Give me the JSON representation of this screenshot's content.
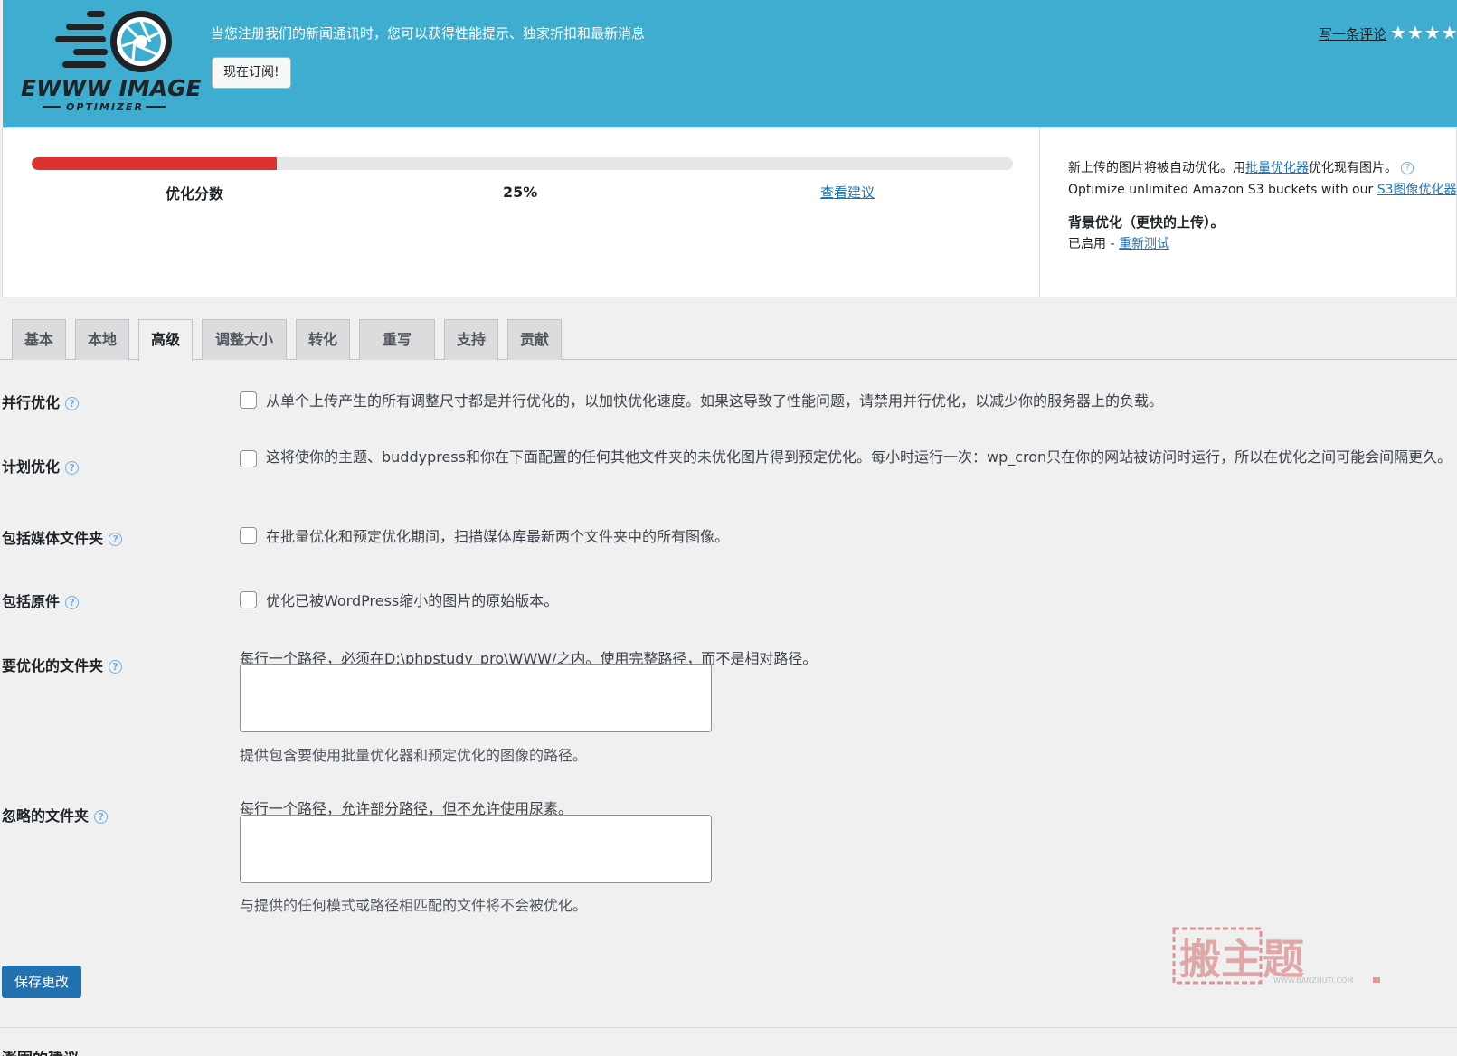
{
  "banner": {
    "logo_text": "EWWW IMAGE",
    "logo_subtext": "OPTIMIZER",
    "newsletter_text": "当您注册我们的新闻通讯时，您可以获得性能提示、独家折扣和最新消息",
    "subscribe_label": "现在订阅!",
    "review_link": "写一条评论",
    "review_stars": "★★★★",
    "bg_color": "#3eadcf"
  },
  "score": {
    "label": "优化分数",
    "percent_text": "25%",
    "percent_value": 25,
    "view_link": "查看建议",
    "fill_color": "#dc3232"
  },
  "side": {
    "line1_prefix": "新上传的图片将被自动优化。用",
    "line1_link": "批量优化器",
    "line1_suffix": "优化现有图片。",
    "line2_prefix": "Optimize unlimited Amazon S3 buckets with our",
    "line2_link": "S3图像优化器",
    "bg_title": "背景优化（更快的上传）。",
    "bg_status": "已启用 -",
    "bg_link": "重新测试"
  },
  "tabs": [
    {
      "label": "基本",
      "active": false
    },
    {
      "label": "本地",
      "active": false
    },
    {
      "label": "高级",
      "active": true
    },
    {
      "label": "调整大小",
      "active": false
    },
    {
      "label": "转化",
      "active": false
    },
    {
      "label": "重写",
      "active": false
    },
    {
      "label": "支持",
      "active": false
    },
    {
      "label": "贡献",
      "active": false
    }
  ],
  "rows": {
    "parallel": {
      "label": "并行优化",
      "text": "从单个上传产生的所有调整尺寸都是并行优化的，以加快优化速度。如果这导致了性能问题，请禁用并行优化，以减少你的服务器上的负载。"
    },
    "scheduled": {
      "label": "计划优化",
      "text": "这将使你的主题、buddypress和你在下面配置的任何其他文件夹的未优化图片得到预定优化。每小时运行一次：wp_cron只在你的网站被访问时运行，所以在优化之间可能会间隔更久。"
    },
    "media_folders": {
      "label": "包括媒体文件夹",
      "text": "在批量优化和预定优化期间，扫描媒体库最新两个文件夹中的所有图像。"
    },
    "originals": {
      "label": "包括原件",
      "text": "优化已被WordPress缩小的图片的原始版本。"
    },
    "folders_to_optimize": {
      "label": "要优化的文件夹",
      "top_text": "每行一个路径，必须在D:\\phpstudy_pro\\WWW/之内。使用完整路径，而不是相对路径。",
      "hint": "提供包含要使用批量优化器和预定优化的图像的路径。",
      "value": ""
    },
    "ignored_folders": {
      "label": "忽略的文件夹",
      "top_text": "每行一个路径，允许部分路径，但不允许使用尿素。",
      "hint": "与提供的任何模式或路径相匹配的文件将不会被优化。",
      "value": ""
    }
  },
  "save_label": "保存更改",
  "bottom_heading": "澎围的建议",
  "watermark": {
    "main": "搬主题",
    "url": "WWW.BANZHUTI.COM"
  }
}
